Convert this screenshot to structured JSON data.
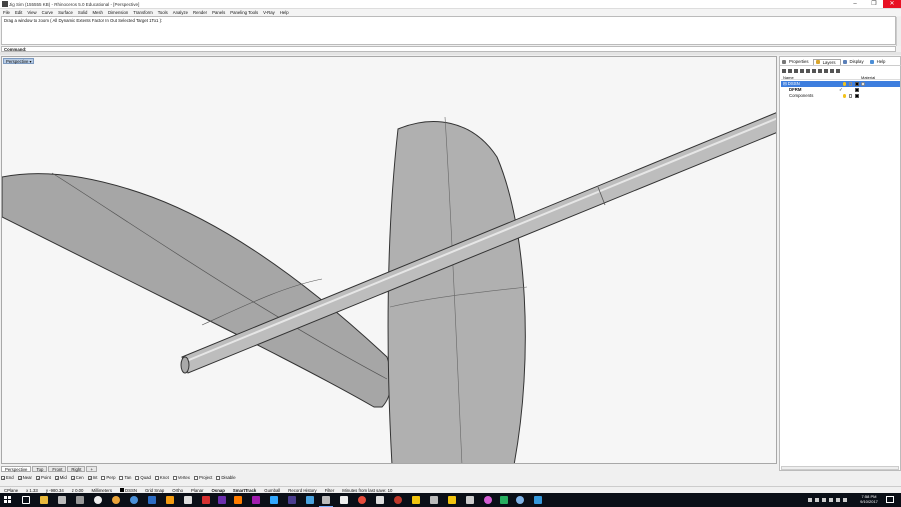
{
  "titlebar": {
    "title": "Jig Sim (155555 KB) - Rhinoceros 5.0 Educational - [Perspective]",
    "min": "–",
    "max": "❐",
    "close": "✕"
  },
  "menu": [
    "File",
    "Edit",
    "View",
    "Curve",
    "Surface",
    "Solid",
    "Mesh",
    "Dimension",
    "Transform",
    "Tools",
    "Analyze",
    "Render",
    "Panels",
    "Paneling Tools",
    "V-Ray",
    "Help"
  ],
  "command": {
    "history": "Drag a window to zoom ( All  Dynamic  Extents  Factor  In  Out  Selected  Target  1To1 ):",
    "prompt": "Command:"
  },
  "viewport": {
    "label": "Perspective"
  },
  "viewport_tabs": [
    "Perspective",
    "Top",
    "Front",
    "Right",
    "+"
  ],
  "osnaps": [
    {
      "label": "End",
      "checked": true
    },
    {
      "label": "Near",
      "checked": true
    },
    {
      "label": "Point",
      "checked": true
    },
    {
      "label": "Mid",
      "checked": true
    },
    {
      "label": "Cen",
      "checked": true
    },
    {
      "label": "Int",
      "checked": true
    },
    {
      "label": "Perp",
      "checked": false
    },
    {
      "label": "Tan",
      "checked": false
    },
    {
      "label": "Quad",
      "checked": false
    },
    {
      "label": "Knot",
      "checked": false
    },
    {
      "label": "Vertex",
      "checked": false
    },
    {
      "label": "Project",
      "checked": false
    },
    {
      "label": "Disable",
      "checked": false
    }
  ],
  "status": {
    "cplane": "CPlane",
    "x": "x 1.33",
    "y": "y -980.34",
    "z": "z 0.00",
    "units": "Millimeters",
    "layer": "DSSN",
    "grid_snap": "Grid Snap",
    "ortho": "Ortho",
    "planar": "Planar",
    "osnap": "Osnap",
    "smarttrack": "SmartTrack",
    "gumball": "Gumball",
    "record_history": "Record History",
    "filter": "Filter",
    "minutes": "Minutes from last save: 10"
  },
  "panel": {
    "tabs": [
      "Properties",
      "Layers",
      "Display",
      "Help"
    ],
    "col_name": "Name",
    "col_material": "Material",
    "layers": [
      {
        "name": "DSSN",
        "selected": true
      },
      {
        "name": "DFRM",
        "selected": false
      },
      {
        "name": "Components",
        "selected": false
      }
    ],
    "check": "✓"
  },
  "taskbar": {
    "time": "7:58 PM",
    "date": "9/10/2017"
  },
  "colors": {
    "surface": "#a6a6a6",
    "surface_dark": "#8a8a8a",
    "viewport_label": "#b9cde5",
    "selected_layer": "#3d7ede"
  }
}
